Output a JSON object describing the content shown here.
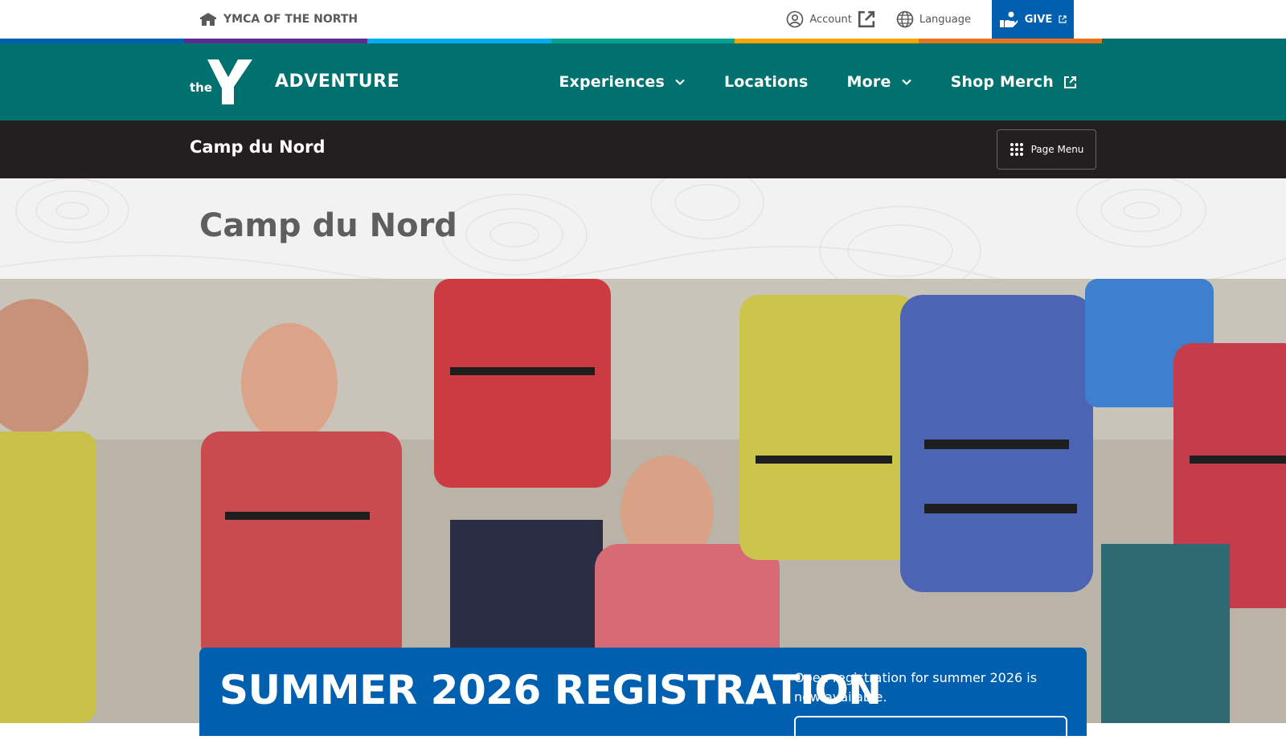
{
  "utility": {
    "org_name": "YMCA OF THE NORTH",
    "account_label": "Account",
    "language_label": "Language",
    "give_label": "GIVE"
  },
  "colors": {
    "teal_nav": "#00716e",
    "dark_subnav": "#231f20",
    "blue_accent": "#0060af",
    "stripe": [
      "#0060af",
      "#5c2d91",
      "#00aeef",
      "#01a490",
      "#f7a600",
      "#e8751a",
      "#00716e"
    ]
  },
  "brand": {
    "logo_text": "the",
    "site_name": "ADVENTURE"
  },
  "nav": {
    "items": [
      {
        "label": "Experiences",
        "icon": "chevron-down-icon"
      },
      {
        "label": "Locations"
      },
      {
        "label": "More",
        "icon": "chevron-down-icon"
      },
      {
        "label": "Shop Merch",
        "icon": "external-link-icon"
      }
    ]
  },
  "subnav": {
    "title": "Camp du Nord",
    "page_menu_label": "Page Menu"
  },
  "page": {
    "title": "Camp du Nord"
  },
  "hero": {
    "image_alt": "photo-of-campers-in-life-jackets"
  },
  "promo": {
    "heading": "SUMMER 2026 REGISTRATION",
    "text": "Open registration for summer 2026 is now available."
  }
}
